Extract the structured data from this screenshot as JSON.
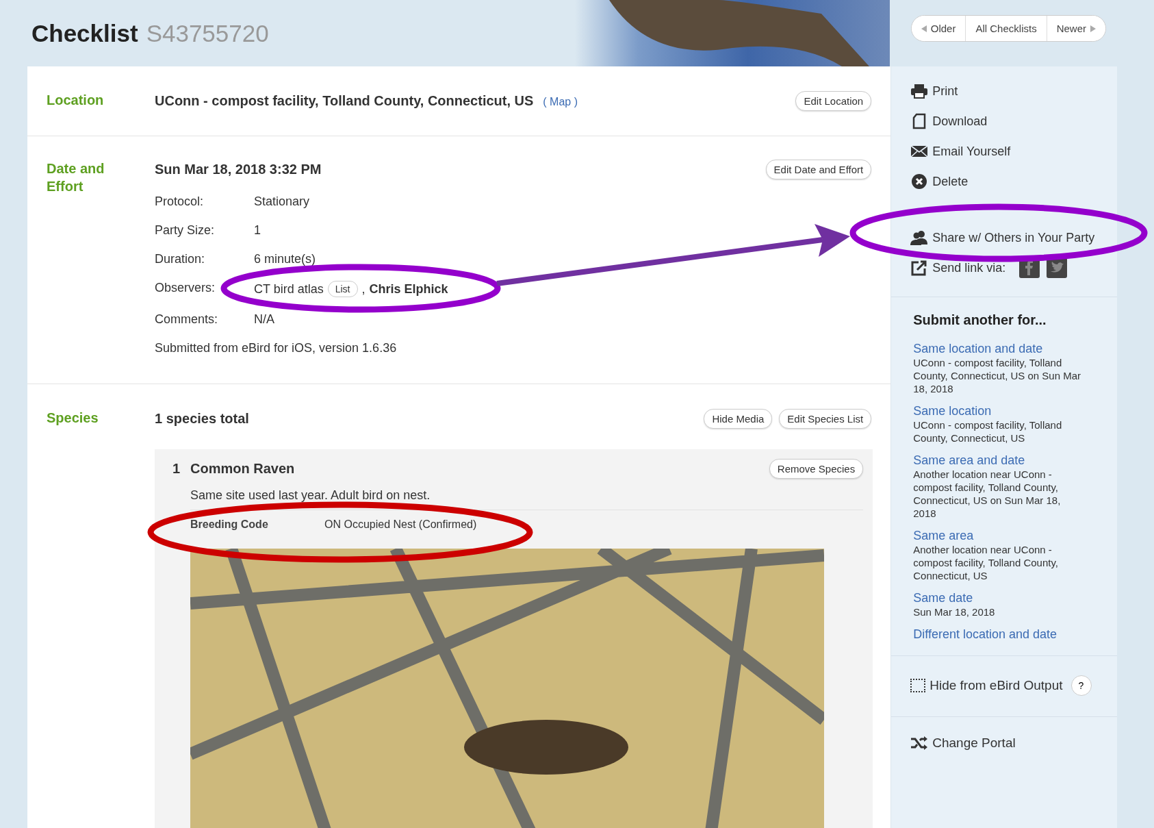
{
  "header": {
    "title": "Checklist",
    "checklist_id": "S43755720",
    "nav": [
      {
        "kind": "prev",
        "label": "Older"
      },
      {
        "kind": "plain",
        "label": "All Checklists"
      },
      {
        "kind": "next",
        "label": "Newer"
      }
    ]
  },
  "location": {
    "label": "Location",
    "value": "UConn - compost facility, Tolland County, Connecticut, US",
    "map_link": "( Map )",
    "edit_button": "Edit Location"
  },
  "date_effort": {
    "label": "Date and Effort",
    "datetime": "Sun Mar 18, 2018 3:32 PM",
    "edit_button": "Edit Date and Effort",
    "fields": [
      {
        "kind": "text",
        "label": "Protocol:",
        "value": "Stationary"
      },
      {
        "kind": "text",
        "label": "Party Size:",
        "value": "1"
      },
      {
        "kind": "text",
        "label": "Duration:",
        "value": "6 minute(s)"
      },
      {
        "kind": "observers",
        "label": "Observers:",
        "group": "CT bird atlas",
        "list_button": "List",
        "separator": ",",
        "observer": "Chris Elphick"
      },
      {
        "kind": "text",
        "label": "Comments:",
        "value": "N/A"
      }
    ],
    "submitted": "Submitted from eBird for iOS, version 1.6.36"
  },
  "species": {
    "label": "Species",
    "total": "1 species total",
    "buttons": [
      "Hide Media",
      "Edit Species List"
    ],
    "items": [
      {
        "number": "1",
        "name": "Common Raven",
        "remove_button": "Remove Species",
        "comment": "Same site used last year. Adult bird on nest.",
        "breeding_label": "Breeding Code",
        "breeding_value": "ON Occupied Nest (Confirmed)"
      }
    ]
  },
  "sidebar": {
    "actions": [
      {
        "kind": "print",
        "label": "Print"
      },
      {
        "kind": "download",
        "label": "Download"
      },
      {
        "kind": "email",
        "label": "Email Yourself"
      },
      {
        "kind": "delete",
        "label": "Delete"
      },
      {
        "kind": "share",
        "label": "Share w/ Others in Your Party"
      },
      {
        "kind": "send",
        "label": "Send link via:"
      }
    ],
    "submit_heading": "Submit another for...",
    "submit_links": [
      {
        "link": "Same location and date",
        "detail": "UConn - compost facility, Tolland County, Connecticut, US on Sun Mar 18, 2018"
      },
      {
        "link": "Same location",
        "detail": "UConn - compost facility, Tolland County, Connecticut, US"
      },
      {
        "link": "Same area and date",
        "detail": "Another location near UConn - compost facility, Tolland County, Connecticut, US on Sun Mar 18, 2018"
      },
      {
        "link": "Same area",
        "detail": "Another location near UConn - compost facility, Tolland County, Connecticut, US"
      },
      {
        "link": "Same date",
        "detail": "Sun Mar 18, 2018"
      },
      {
        "link": "Different location and date"
      }
    ],
    "hide_output": {
      "label": "Hide from eBird Output",
      "checked": false,
      "help": "?"
    },
    "change_portal": "Change Portal"
  },
  "annotations": [
    {
      "kind": "ellipse",
      "color": "#9400cc"
    },
    {
      "kind": "arrow",
      "color": "#7030a0"
    },
    {
      "kind": "ellipse",
      "color": "#9400cc"
    },
    {
      "kind": "ellipse",
      "color": "#cc0000"
    }
  ]
}
